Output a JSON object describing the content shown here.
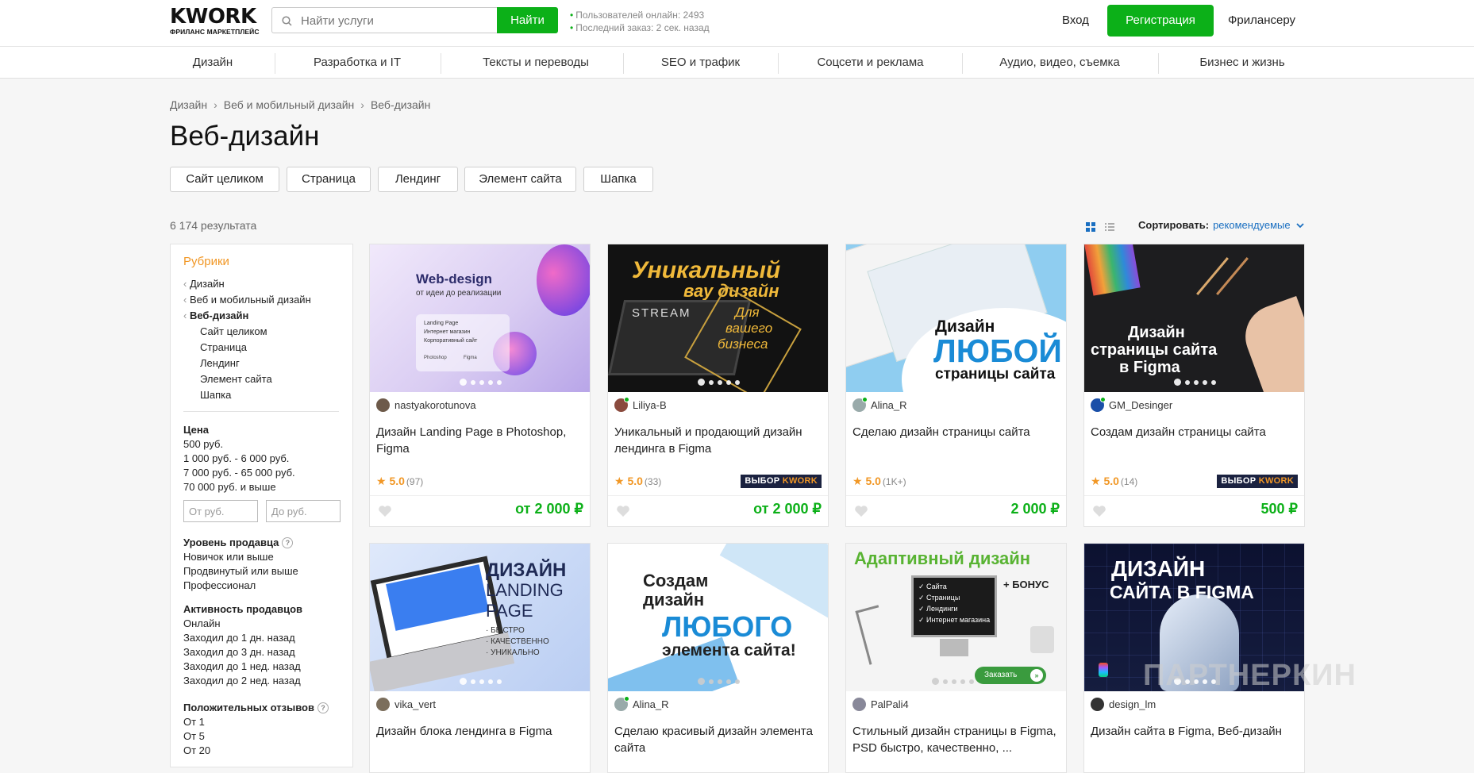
{
  "header": {
    "logo_main": "KWORK",
    "logo_sub": "ФРИЛАНС МАРКЕТПЛЕЙС",
    "search_placeholder": "Найти услуги",
    "search_button": "Найти",
    "online_users": "Пользователей онлайн: 2493",
    "last_order": "Последний заказ: 2 сек. назад",
    "login": "Вход",
    "register": "Регистрация",
    "freelancer": "Фрилансеру"
  },
  "categories": [
    "Дизайн",
    "Разработка и IT",
    "Тексты и переводы",
    "SEO и трафик",
    "Соцсети и реклама",
    "Аудио, видео, съемка",
    "Бизнес и жизнь"
  ],
  "breadcrumbs": [
    "Дизайн",
    "Веб и мобильный дизайн",
    "Веб-дизайн"
  ],
  "page_title": "Веб-дизайн",
  "chips": [
    "Сайт целиком",
    "Страница",
    "Лендинг",
    "Элемент сайта",
    "Шапка"
  ],
  "results_count": "6 174 результата",
  "sort": {
    "label": "Сортировать:",
    "value": "рекомендуемые"
  },
  "sidebar": {
    "rubrics_title": "Рубрики",
    "rubrics_parents": [
      "Дизайн",
      "Веб и мобильный дизайн",
      "Веб-дизайн"
    ],
    "rubrics_children": [
      "Сайт целиком",
      "Страница",
      "Лендинг",
      "Элемент сайта",
      "Шапка"
    ],
    "price_title": "Цена",
    "price_options": [
      "500 руб.",
      "1 000 руб. - 6 000 руб.",
      "7 000 руб. - 65 000 руб.",
      "70 000 руб. и выше"
    ],
    "price_from_placeholder": "От руб.",
    "price_to_placeholder": "До руб.",
    "level_title": "Уровень продавца",
    "level_options": [
      "Новичок или выше",
      "Продвинутый или выше",
      "Профессионал"
    ],
    "activity_title": "Активность продавцов",
    "activity_options": [
      "Онлайн",
      "Заходил до 1 дн. назад",
      "Заходил до 3 дн. назад",
      "Заходил до 1 нед. назад",
      "Заходил до 2 нед. назад"
    ],
    "reviews_title": "Положительных отзывов",
    "reviews_options": [
      "От 1",
      "От 5",
      "От 20"
    ]
  },
  "cards": [
    {
      "seller": "nastyakorotunova",
      "title": "Дизайн Landing Page в Photoshop, Figma",
      "rating": "5.0",
      "reviews": "(97)",
      "badge": false,
      "price": "от 2 000 ₽",
      "img": {
        "l1": "Web-design",
        "l2": "от идеи до реализации",
        "l3": "Landing Page",
        "l4": "Интернет магазин",
        "l5": "Корпоративный сайт",
        "l6": "Photoshop",
        "l7": "Figma"
      }
    },
    {
      "seller": "Liliya-B",
      "title": "Уникальный и продающий дизайн лендинга в Figma",
      "rating": "5.0",
      "reviews": "(33)",
      "badge": true,
      "price": "от 2 000 ₽",
      "img": {
        "l1": "Уникальный",
        "l2": "вау дизайн",
        "l3": "Для",
        "l4": "вашего",
        "l5": "бизнеса",
        "l6": "STREAM"
      }
    },
    {
      "seller": "Alina_R",
      "title": "Сделаю дизайн страницы сайта",
      "rating": "5.0",
      "reviews": "(1K+)",
      "badge": false,
      "price": "2 000 ₽",
      "img": {
        "l1": "Дизайн",
        "l2": "ЛЮБОЙ",
        "l3": "страницы сайта"
      }
    },
    {
      "seller": "GM_Desinger",
      "title": "Создам дизайн страницы сайта",
      "rating": "5.0",
      "reviews": "(14)",
      "badge": true,
      "price": "500 ₽",
      "img": {
        "l1": "Дизайн",
        "l2": "страницы сайта",
        "l3": "в Figma"
      }
    },
    {
      "seller": "vika_vert",
      "title": "Дизайн блока лендинга в Figma",
      "rating": "",
      "reviews": "",
      "badge": false,
      "price": "",
      "img": {
        "l1": "ДИЗАЙН",
        "l2": "LANDING",
        "l3": "PAGE",
        "l4": "· БЫСТРО",
        "l5": "· КАЧЕСТВЕННО",
        "l6": "· УНИКАЛЬНО"
      }
    },
    {
      "seller": "Alina_R",
      "title": "Сделаю красивый дизайн элемента сайта",
      "rating": "",
      "reviews": "",
      "badge": false,
      "price": "",
      "img": {
        "l1": "Создам",
        "l2": "дизайн",
        "l3": "ЛЮБОГО",
        "l4": "элемента сайта!"
      }
    },
    {
      "seller": "PalPali4",
      "title": "Стильный дизайн страницы в Figma, PSD быстро, качественно, ...",
      "rating": "",
      "reviews": "",
      "badge": false,
      "price": "",
      "img": {
        "l1": "Адаптивный дизайн",
        "l2": "+ БОНУС",
        "l3": "Сайта",
        "l4": "Страницы",
        "l5": "Лендинги",
        "l6": "Интернет магазина",
        "l7": "Заказать"
      }
    },
    {
      "seller": "design_lm",
      "title": "Дизайн сайта в Figma, Веб-дизайн",
      "rating": "",
      "reviews": "",
      "badge": false,
      "price": "",
      "img": {
        "l1": "ДИЗАЙН",
        "l2": "САЙТА В FIGMA"
      }
    }
  ],
  "badge": {
    "left": "ВЫБОР ",
    "right": "KWORK"
  },
  "watermark": "ПАРТНЕРКИН",
  "colors": {
    "brand_green": "#0cb018",
    "accent_orange": "#f19725",
    "link_blue": "#1a6fc1"
  }
}
